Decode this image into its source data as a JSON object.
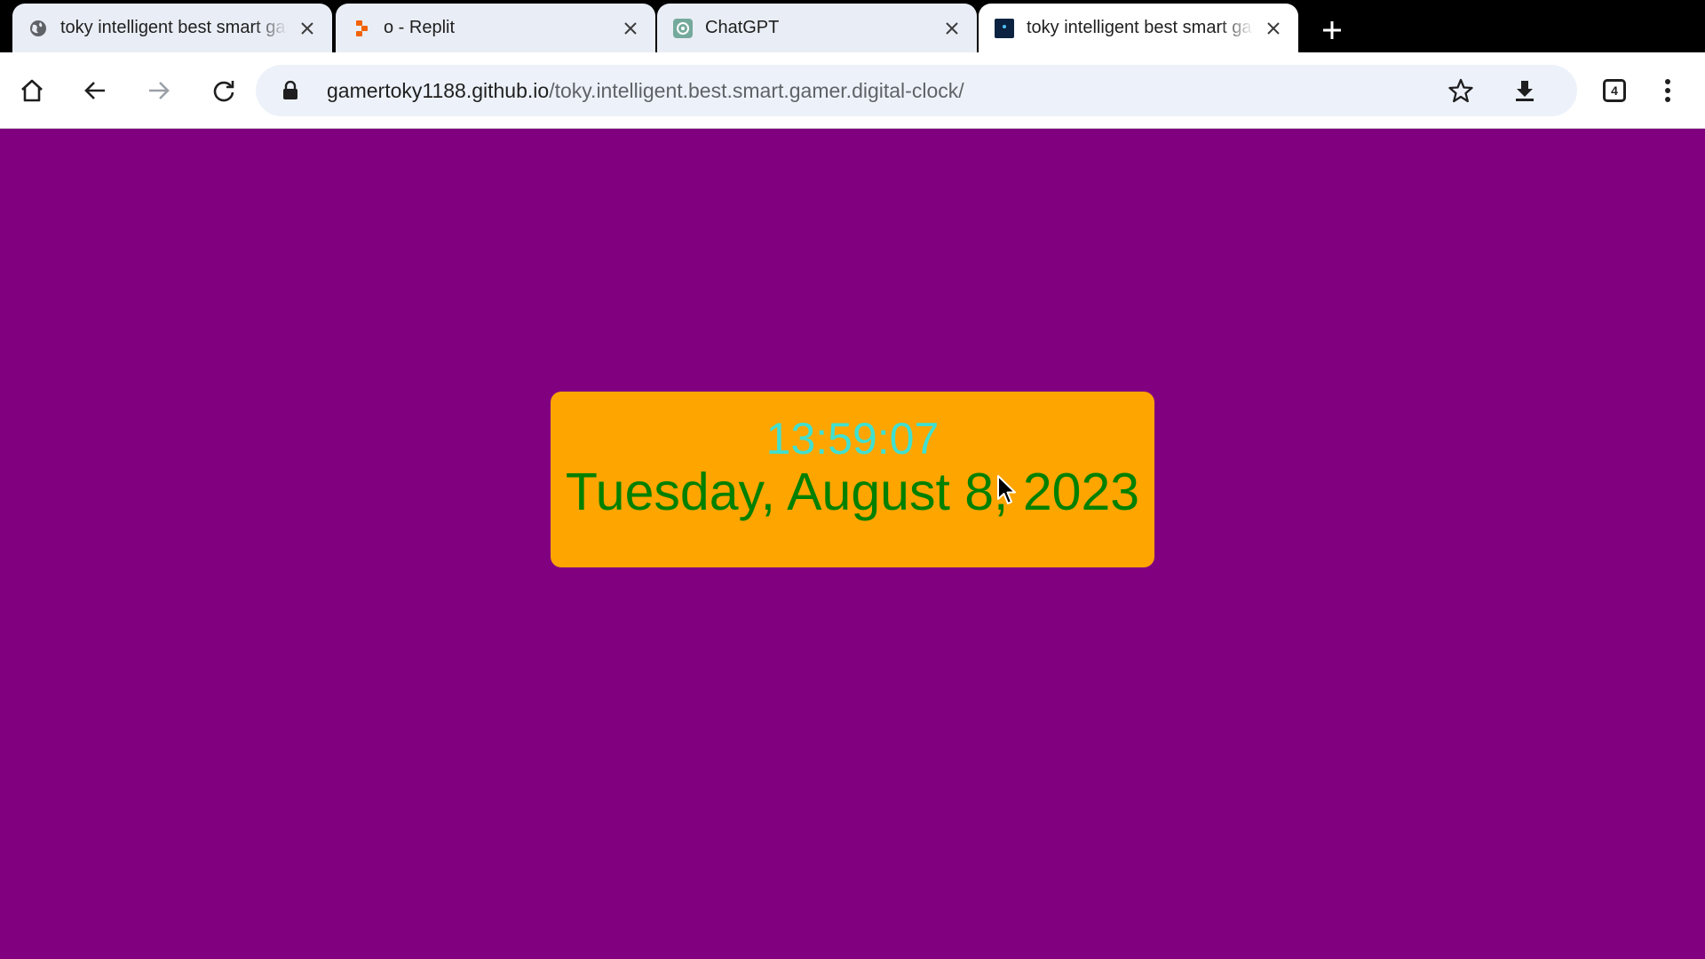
{
  "browser": {
    "tabs": [
      {
        "title": "toky intelligent best smart gamer digital clock",
        "favicon": "globe-icon",
        "active": false
      },
      {
        "title": "o - Replit",
        "favicon": "replit-icon",
        "active": false
      },
      {
        "title": "ChatGPT",
        "favicon": "chatgpt-icon",
        "active": false
      },
      {
        "title": "toky intelligent best smart gamer digital clock",
        "favicon": "site-icon",
        "active": true
      }
    ],
    "address_bar": {
      "domain": "gamertoky1188.github.io",
      "path": "/toky.intelligent.best.smart.gamer.digital-clock/"
    },
    "tab_count": "4"
  },
  "page": {
    "background_color": "#800080",
    "clock": {
      "time": "13:59:07",
      "date": "Tuesday, August 8, 2023",
      "card_color": "#ffa500",
      "time_color": "#40e0d0",
      "date_color": "#008000"
    }
  }
}
